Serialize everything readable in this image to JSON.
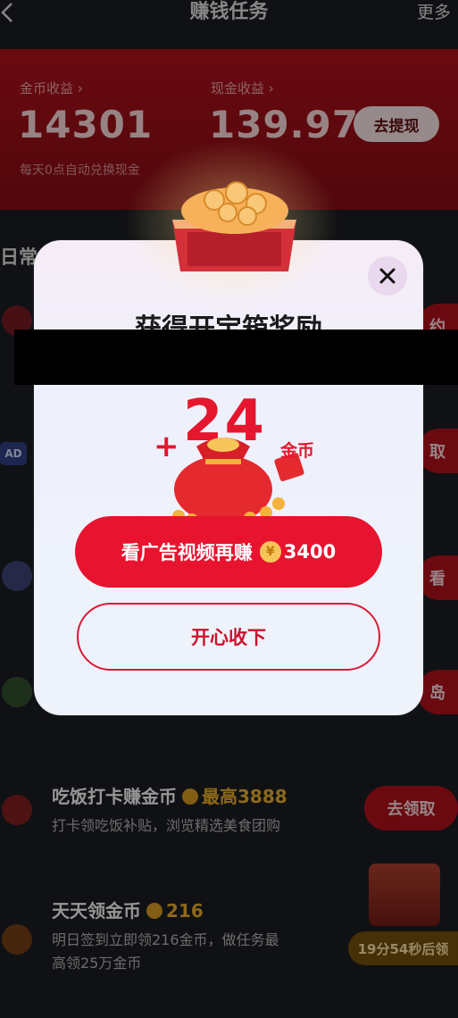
{
  "header": {
    "title": "赚钱任务",
    "more": "更多"
  },
  "earnings": {
    "coin_label": "金币收益 ›",
    "coin_value": "14301",
    "cash_label": "现金收益 ›",
    "cash_value": "139.97",
    "withdraw_label": "去提现",
    "auto_note": "每天0点自动兑换现金"
  },
  "daily_section": {
    "title": "日常任"
  },
  "edge_buttons": {
    "row1": "约",
    "row2": "取",
    "row3": "看",
    "row4": "岛"
  },
  "tasks": [
    {
      "title": "吃饭打卡赚金币",
      "reward": "最高3888",
      "desc": "打卡领吃饭补贴，浏览精选美食团购",
      "button": "去领取"
    },
    {
      "title": "天天领金币",
      "reward": "216",
      "desc_line1": "明日签到立即领216金币，做任务最",
      "desc_line2": "高领25万金币",
      "timer": "19分54秒后领"
    }
  ],
  "modal": {
    "title": "获得开宝箱奖励",
    "plus": "+",
    "amount": "24",
    "unit": "金币",
    "ad_button_text": "看广告视频再赚",
    "ad_button_coin_symbol": "¥",
    "ad_button_amount": "3400",
    "accept_button": "开心收下"
  },
  "colors": {
    "accent_red": "#e8132f",
    "reward_gold": "#d9a22a",
    "modal_bg": "#eef2fb"
  },
  "icons": [
    "back-icon",
    "close-icon",
    "chest-icon",
    "lucky-bag-icon",
    "coin-icon",
    "gift-box-icon"
  ]
}
